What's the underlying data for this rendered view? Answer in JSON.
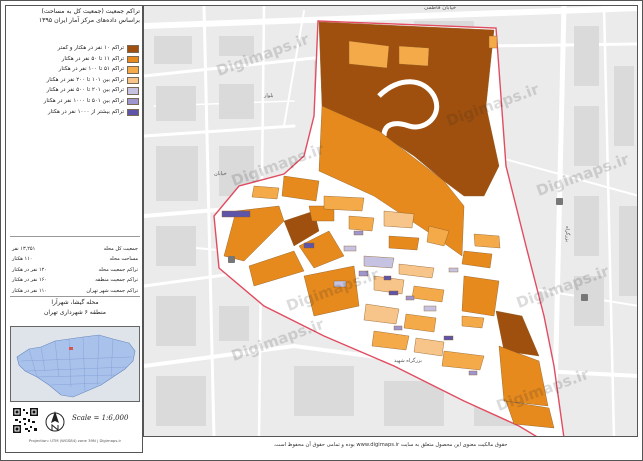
{
  "sidebar": {
    "title_line1": "تراکم جمعیت (جمعیت کل به مساحت)",
    "title_line2": "براساس داده‌های مرکز آمار ایران ۱۳۹۵",
    "legend": [
      {
        "label": "تراکم ۱۰ نفر در هکتار و کمتر",
        "color": "#a0500e"
      },
      {
        "label": "تراکم ۱۱ تا ۵۰ نفر در هکتار",
        "color": "#e68a1e"
      },
      {
        "label": "تراکم ۵۱ تا ۱۰۰ نفر در هکتار",
        "color": "#f5aa4a"
      },
      {
        "label": "تراکم بین ۱۰۱ تا ۲۰۰ نفر در هکتار",
        "color": "#f7c58a"
      },
      {
        "label": "تراکم بین ۲۰۱ تا ۵۰۰ نفر در هکتار",
        "color": "#c6c3e2"
      },
      {
        "label": "تراکم بین ۵۰۱ تا ۱۰۰۰ نفر در هکتار",
        "color": "#9e97cf"
      },
      {
        "label": "تراکم بیشتر از ۱۰۰۰ نفر در هکتار",
        "color": "#5f55a8"
      }
    ],
    "stats": [
      {
        "label": "جمعیت کل محله",
        "value": "۱۳,۲۵۱ نفر"
      },
      {
        "label": "مساحت محله",
        "value": "۱۱۰ هکتار"
      },
      {
        "label": "تراکم جمعیت محله",
        "value": "۱۲۰ نفر در هکتار"
      },
      {
        "label": "تراکم جمعیت منطقه",
        "value": "۱۶۰ نفر در هکتار"
      },
      {
        "label": "تراکم جمعیت شهر تهران",
        "value": "۱۱۰ نفر در هکتار"
      }
    ],
    "location_line1": "محله گیشا، شهرآرا",
    "location_line2": "منطقه ۶ شهرداری تهران",
    "scale": "Scale = 1:6,000",
    "footer": "Projection: UTM (WGS84) zone 39N | Digimaps.ir"
  },
  "map": {
    "labels": {
      "top_street": "خیابان فاطمی",
      "right_street": "بزرگراه",
      "bottom_street": "بزرگراه شهید",
      "street_mid1": "خیابان",
      "street_mid2": "بلوار"
    },
    "watermarks": [
      "Digimaps.ir",
      "Digimaps.ir",
      "Digimaps.ir",
      "Digimaps.ir",
      "Digimaps.ir",
      "Digimaps.ir",
      "Digimaps.ir",
      "Digimaps.ir"
    ]
  },
  "notice": "حقوق مالکیت معنوی این محصول متعلق به سایت www.digimaps.ir بوده و تمامی حقوق آن محفوظ است."
}
